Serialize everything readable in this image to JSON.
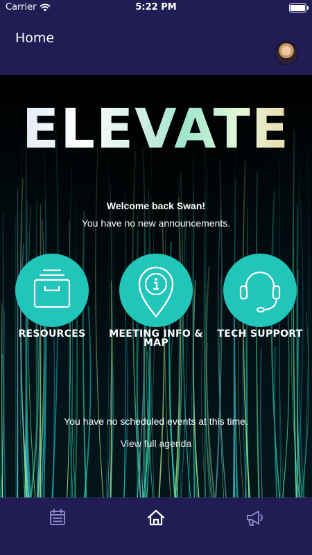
{
  "status_bar": {
    "carrier": "Carrier",
    "time": "5:22 PM",
    "icons": [
      "wifi-icon",
      "battery-icon"
    ]
  },
  "nav": {
    "title": "Home",
    "avatar": "user-avatar-icon"
  },
  "hero": {
    "logo_text": "ELEVATE",
    "welcome": "Welcome back Swan!",
    "announcements": "You have no new announcements."
  },
  "tiles": [
    {
      "label": "RESOURCES",
      "icon": "archive-box-icon"
    },
    {
      "label": "MEETING INFO & MAP",
      "icon": "info-pin-icon"
    },
    {
      "label": "TECH SUPPORT",
      "icon": "headset-icon"
    }
  ],
  "events": {
    "empty_text": "You have no scheduled events at this time.",
    "agenda_link": "View full agenda"
  },
  "tab_bar": {
    "items": [
      "calendar-icon",
      "home-icon",
      "megaphone-icon"
    ],
    "active": "home-icon"
  },
  "colors": {
    "nav_bg": "#211d54",
    "accent": "#21c5ba",
    "icon_inactive": "#8a86c4",
    "icon_active": "#ffffff"
  }
}
